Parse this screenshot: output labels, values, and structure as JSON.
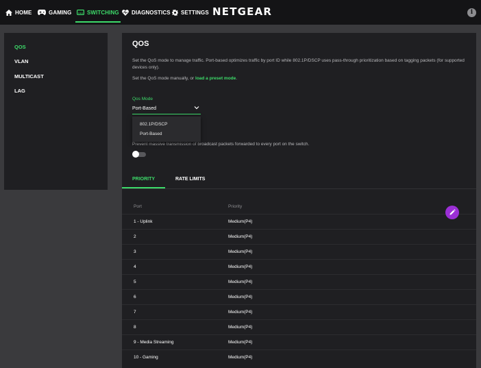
{
  "nav": {
    "items": [
      {
        "label": "HOME",
        "icon": "home-icon",
        "active": false
      },
      {
        "label": "GAMING",
        "icon": "gamepad-icon",
        "active": false
      },
      {
        "label": "SWITCHING",
        "icon": "switch-icon",
        "active": true
      },
      {
        "label": "DIAGNOSTICS",
        "icon": "heartbeat-icon",
        "active": false
      },
      {
        "label": "SETTINGS",
        "icon": "gear-icon",
        "active": false
      }
    ],
    "brand": "NETGEAR",
    "info_icon": "info-icon"
  },
  "sidebar": {
    "items": [
      {
        "label": "QOS",
        "active": true
      },
      {
        "label": "VLAN",
        "active": false
      },
      {
        "label": "MULTICAST",
        "active": false
      },
      {
        "label": "LAG",
        "active": false
      }
    ]
  },
  "main": {
    "title": "QOS",
    "description": "Set the QoS mode to manage traffic. Port-based optimizes traffic by port ID while 802.1P/DSCP uses pass-through prioritization based on tagging packets (for supported devices only).",
    "manual_prefix": "Set the QoS mode manually, or ",
    "manual_link": "load a preset mode",
    "manual_suffix": ".",
    "qos_mode": {
      "label": "Qos Mode",
      "value": "Port-Based",
      "options": [
        "802.1P/DSCP",
        "Port-Based"
      ]
    },
    "broadcast_desc": "Prevent massive transmission of broadcast packets forwarded to every port on the switch.",
    "tabs": [
      {
        "label": "PRIORITY",
        "active": true
      },
      {
        "label": "RATE LIMITS",
        "active": false
      }
    ],
    "table": {
      "columns": [
        "Port",
        "Priority"
      ],
      "rows": [
        {
          "port": "1 - Uplink",
          "priority": "Medium(P4)"
        },
        {
          "port": "2",
          "priority": "Medium(P4)"
        },
        {
          "port": "3",
          "priority": "Medium(P4)"
        },
        {
          "port": "4",
          "priority": "Medium(P4)"
        },
        {
          "port": "5",
          "priority": "Medium(P4)"
        },
        {
          "port": "6",
          "priority": "Medium(P4)"
        },
        {
          "port": "7",
          "priority": "Medium(P4)"
        },
        {
          "port": "8",
          "priority": "Medium(P4)"
        },
        {
          "port": "9 - Media Streaming",
          "priority": "Medium(P4)"
        },
        {
          "port": "10 - Gaming",
          "priority": "Medium(P4)"
        }
      ]
    },
    "edit_icon": "pencil-icon"
  },
  "colors": {
    "accent": "#3ddc6a",
    "fab": "#9b2fd6",
    "nav_bg": "#141416",
    "panel_bg": "#1f1f22",
    "page_bg": "#3a3a3d"
  }
}
